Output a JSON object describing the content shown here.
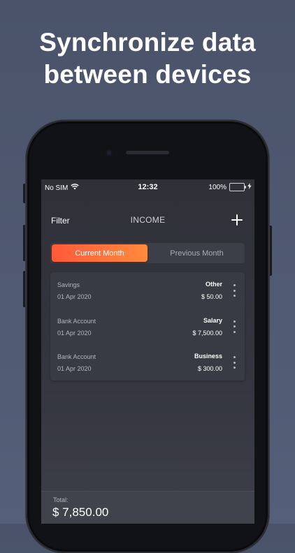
{
  "promo": {
    "headline_line1": "Synchronize data",
    "headline_line2": "between devices"
  },
  "status_bar": {
    "carrier": "No SIM",
    "time": "12:32",
    "battery": "100%",
    "battery_level": 1.0,
    "icons": [
      "wifi-icon",
      "battery-icon",
      "charging-bolt-icon"
    ]
  },
  "nav": {
    "filter_label": "Filter",
    "title": "INCOME",
    "add_icon": "plus-icon"
  },
  "segments": [
    {
      "label": "Current Month",
      "selected": true
    },
    {
      "label": "Previous Month",
      "selected": false
    }
  ],
  "transactions": [
    {
      "account": "Savings",
      "date": "01 Apr 2020",
      "category": "Other",
      "amount": "$ 50.00"
    },
    {
      "account": "Bank Account",
      "date": "01 Apr 2020",
      "category": "Salary",
      "amount": "$ 7,500.00"
    },
    {
      "account": "Bank Account",
      "date": "01 Apr 2020",
      "category": "Business",
      "amount": "$ 300.00"
    }
  ],
  "footer": {
    "total_label": "Total:",
    "total_value": "$ 7,850.00"
  },
  "colors": {
    "accent_start": "#ff5a3a",
    "accent_end": "#ff8a3d",
    "battery_green": "#4cd964",
    "background": "#4f5870"
  }
}
